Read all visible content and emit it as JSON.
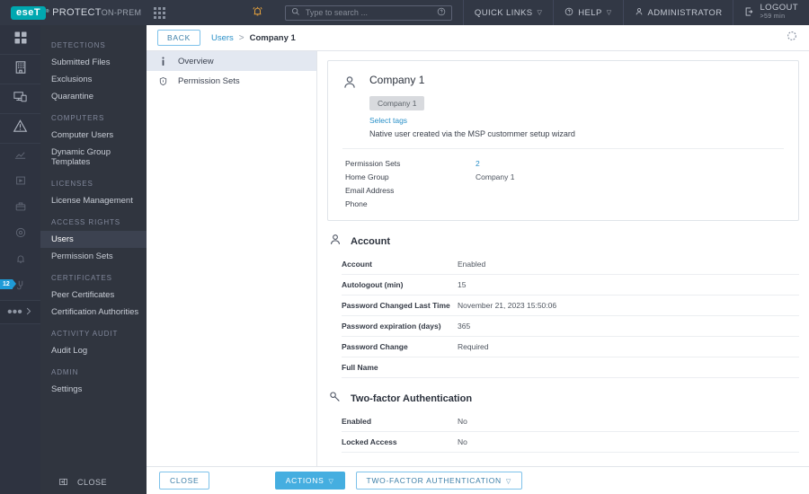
{
  "header": {
    "logo_text": "eseT",
    "logo_mark": "®",
    "product": "PROTECT",
    "product_suffix": "ON-PREM",
    "apps_icon": "apps-grid-icon",
    "bell_icon": "notification-bell-icon",
    "search": {
      "placeholder": "Type to search ...",
      "value": "",
      "icon": "search-icon",
      "help_icon": "question-circle-icon"
    },
    "quick_links": "QUICK LINKS",
    "help": "HELP",
    "administrator": "ADMINISTRATOR",
    "logout": "LOGOUT",
    "session_time": ">59 min",
    "accent": "#00a8b0",
    "bell_color": "#e8a33d"
  },
  "rail": {
    "items": [
      {
        "name": "dashboard-icon",
        "badge": ""
      },
      {
        "name": "building-icon",
        "badge": ""
      },
      {
        "name": "computers-icon",
        "badge": ""
      },
      {
        "name": "alert-triangle-icon",
        "badge": ""
      },
      {
        "name": "reports-icon",
        "badge": ""
      },
      {
        "name": "tasks-icon",
        "badge": ""
      },
      {
        "name": "installers-icon",
        "badge": ""
      },
      {
        "name": "policies-icon",
        "badge": ""
      },
      {
        "name": "notifications-icon",
        "badge": ""
      },
      {
        "name": "status-overview-icon",
        "badge": "12"
      }
    ],
    "more_label": "•••",
    "badge_color": "#1f9bd7"
  },
  "sidebar": {
    "groups": [
      {
        "title": "DETECTIONS",
        "items": [
          {
            "label": "Submitted Files",
            "active": false
          },
          {
            "label": "Exclusions",
            "active": false
          },
          {
            "label": "Quarantine",
            "active": false
          }
        ]
      },
      {
        "title": "COMPUTERS",
        "items": [
          {
            "label": "Computer Users",
            "active": false
          },
          {
            "label": "Dynamic Group Templates",
            "active": false
          }
        ]
      },
      {
        "title": "LICENSES",
        "items": [
          {
            "label": "License Management",
            "active": false
          }
        ]
      },
      {
        "title": "ACCESS RIGHTS",
        "items": [
          {
            "label": "Users",
            "active": true
          },
          {
            "label": "Permission Sets",
            "active": false
          }
        ]
      },
      {
        "title": "CERTIFICATES",
        "items": [
          {
            "label": "Peer Certificates",
            "active": false
          },
          {
            "label": "Certification Authorities",
            "active": false
          }
        ]
      },
      {
        "title": "ACTIVITY AUDIT",
        "items": [
          {
            "label": "Audit Log",
            "active": false
          }
        ]
      },
      {
        "title": "ADMIN",
        "items": [
          {
            "label": "Settings",
            "active": false
          }
        ]
      }
    ],
    "footer": {
      "label": "CLOSE",
      "icon": "collapse-panel-icon"
    }
  },
  "breadcrumb": {
    "back_label": "BACK",
    "parent": "Users",
    "separator": ">",
    "current": "Company 1",
    "refresh_icon": "refresh-icon"
  },
  "tabs": [
    {
      "label": "Overview",
      "icon": "info-icon",
      "active": true
    },
    {
      "label": "Permission Sets",
      "icon": "shield-icon",
      "active": false
    }
  ],
  "user_card": {
    "avatar_icon": "person-icon",
    "name": "Company 1",
    "tag": "Company 1",
    "select_tags_label": "Select tags",
    "description": "Native user created via the MSP custommer setup wizard",
    "fields": [
      {
        "key": "Permission Sets",
        "value": "2",
        "is_link": true
      },
      {
        "key": "Home Group",
        "value": "Company 1",
        "is_link": false
      },
      {
        "key": "Email Address",
        "value": "",
        "is_link": false
      },
      {
        "key": "Phone",
        "value": "",
        "is_link": false
      }
    ]
  },
  "account_section": {
    "icon": "person-icon",
    "title": "Account",
    "rows": [
      {
        "key": "Account",
        "value": "Enabled"
      },
      {
        "key": "Autologout (min)",
        "value": "15"
      },
      {
        "key": "Password Changed Last Time",
        "value": "November 21, 2023 15:50:06"
      },
      {
        "key": "Password expiration (days)",
        "value": "365"
      },
      {
        "key": "Password Change",
        "value": "Required"
      },
      {
        "key": "Full Name",
        "value": ""
      }
    ]
  },
  "twofactor_section": {
    "icon": "key-icon",
    "title": "Two-factor Authentication",
    "rows": [
      {
        "key": "Enabled",
        "value": "No"
      },
      {
        "key": "Locked Access",
        "value": "No"
      }
    ]
  },
  "footer": {
    "close_label": "CLOSE",
    "actions_label": "ACTIONS",
    "twofactor_label": "TWO-FACTOR AUTHENTICATION",
    "caret": "▽",
    "primary_color": "#45aee0"
  }
}
